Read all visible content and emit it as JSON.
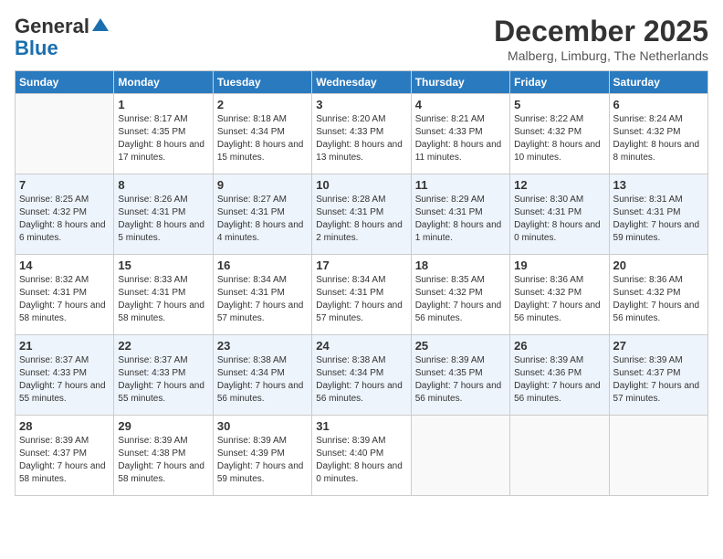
{
  "header": {
    "logo_general": "General",
    "logo_blue": "Blue",
    "month_title": "December 2025",
    "location": "Malberg, Limburg, The Netherlands"
  },
  "weekdays": [
    "Sunday",
    "Monday",
    "Tuesday",
    "Wednesday",
    "Thursday",
    "Friday",
    "Saturday"
  ],
  "weeks": [
    [
      {
        "day": "",
        "sunrise": "",
        "sunset": "",
        "daylight": ""
      },
      {
        "day": "1",
        "sunrise": "Sunrise: 8:17 AM",
        "sunset": "Sunset: 4:35 PM",
        "daylight": "Daylight: 8 hours and 17 minutes."
      },
      {
        "day": "2",
        "sunrise": "Sunrise: 8:18 AM",
        "sunset": "Sunset: 4:34 PM",
        "daylight": "Daylight: 8 hours and 15 minutes."
      },
      {
        "day": "3",
        "sunrise": "Sunrise: 8:20 AM",
        "sunset": "Sunset: 4:33 PM",
        "daylight": "Daylight: 8 hours and 13 minutes."
      },
      {
        "day": "4",
        "sunrise": "Sunrise: 8:21 AM",
        "sunset": "Sunset: 4:33 PM",
        "daylight": "Daylight: 8 hours and 11 minutes."
      },
      {
        "day": "5",
        "sunrise": "Sunrise: 8:22 AM",
        "sunset": "Sunset: 4:32 PM",
        "daylight": "Daylight: 8 hours and 10 minutes."
      },
      {
        "day": "6",
        "sunrise": "Sunrise: 8:24 AM",
        "sunset": "Sunset: 4:32 PM",
        "daylight": "Daylight: 8 hours and 8 minutes."
      }
    ],
    [
      {
        "day": "7",
        "sunrise": "Sunrise: 8:25 AM",
        "sunset": "Sunset: 4:32 PM",
        "daylight": "Daylight: 8 hours and 6 minutes."
      },
      {
        "day": "8",
        "sunrise": "Sunrise: 8:26 AM",
        "sunset": "Sunset: 4:31 PM",
        "daylight": "Daylight: 8 hours and 5 minutes."
      },
      {
        "day": "9",
        "sunrise": "Sunrise: 8:27 AM",
        "sunset": "Sunset: 4:31 PM",
        "daylight": "Daylight: 8 hours and 4 minutes."
      },
      {
        "day": "10",
        "sunrise": "Sunrise: 8:28 AM",
        "sunset": "Sunset: 4:31 PM",
        "daylight": "Daylight: 8 hours and 2 minutes."
      },
      {
        "day": "11",
        "sunrise": "Sunrise: 8:29 AM",
        "sunset": "Sunset: 4:31 PM",
        "daylight": "Daylight: 8 hours and 1 minute."
      },
      {
        "day": "12",
        "sunrise": "Sunrise: 8:30 AM",
        "sunset": "Sunset: 4:31 PM",
        "daylight": "Daylight: 8 hours and 0 minutes."
      },
      {
        "day": "13",
        "sunrise": "Sunrise: 8:31 AM",
        "sunset": "Sunset: 4:31 PM",
        "daylight": "Daylight: 7 hours and 59 minutes."
      }
    ],
    [
      {
        "day": "14",
        "sunrise": "Sunrise: 8:32 AM",
        "sunset": "Sunset: 4:31 PM",
        "daylight": "Daylight: 7 hours and 58 minutes."
      },
      {
        "day": "15",
        "sunrise": "Sunrise: 8:33 AM",
        "sunset": "Sunset: 4:31 PM",
        "daylight": "Daylight: 7 hours and 58 minutes."
      },
      {
        "day": "16",
        "sunrise": "Sunrise: 8:34 AM",
        "sunset": "Sunset: 4:31 PM",
        "daylight": "Daylight: 7 hours and 57 minutes."
      },
      {
        "day": "17",
        "sunrise": "Sunrise: 8:34 AM",
        "sunset": "Sunset: 4:31 PM",
        "daylight": "Daylight: 7 hours and 57 minutes."
      },
      {
        "day": "18",
        "sunrise": "Sunrise: 8:35 AM",
        "sunset": "Sunset: 4:32 PM",
        "daylight": "Daylight: 7 hours and 56 minutes."
      },
      {
        "day": "19",
        "sunrise": "Sunrise: 8:36 AM",
        "sunset": "Sunset: 4:32 PM",
        "daylight": "Daylight: 7 hours and 56 minutes."
      },
      {
        "day": "20",
        "sunrise": "Sunrise: 8:36 AM",
        "sunset": "Sunset: 4:32 PM",
        "daylight": "Daylight: 7 hours and 56 minutes."
      }
    ],
    [
      {
        "day": "21",
        "sunrise": "Sunrise: 8:37 AM",
        "sunset": "Sunset: 4:33 PM",
        "daylight": "Daylight: 7 hours and 55 minutes."
      },
      {
        "day": "22",
        "sunrise": "Sunrise: 8:37 AM",
        "sunset": "Sunset: 4:33 PM",
        "daylight": "Daylight: 7 hours and 55 minutes."
      },
      {
        "day": "23",
        "sunrise": "Sunrise: 8:38 AM",
        "sunset": "Sunset: 4:34 PM",
        "daylight": "Daylight: 7 hours and 56 minutes."
      },
      {
        "day": "24",
        "sunrise": "Sunrise: 8:38 AM",
        "sunset": "Sunset: 4:34 PM",
        "daylight": "Daylight: 7 hours and 56 minutes."
      },
      {
        "day": "25",
        "sunrise": "Sunrise: 8:39 AM",
        "sunset": "Sunset: 4:35 PM",
        "daylight": "Daylight: 7 hours and 56 minutes."
      },
      {
        "day": "26",
        "sunrise": "Sunrise: 8:39 AM",
        "sunset": "Sunset: 4:36 PM",
        "daylight": "Daylight: 7 hours and 56 minutes."
      },
      {
        "day": "27",
        "sunrise": "Sunrise: 8:39 AM",
        "sunset": "Sunset: 4:37 PM",
        "daylight": "Daylight: 7 hours and 57 minutes."
      }
    ],
    [
      {
        "day": "28",
        "sunrise": "Sunrise: 8:39 AM",
        "sunset": "Sunset: 4:37 PM",
        "daylight": "Daylight: 7 hours and 58 minutes."
      },
      {
        "day": "29",
        "sunrise": "Sunrise: 8:39 AM",
        "sunset": "Sunset: 4:38 PM",
        "daylight": "Daylight: 7 hours and 58 minutes."
      },
      {
        "day": "30",
        "sunrise": "Sunrise: 8:39 AM",
        "sunset": "Sunset: 4:39 PM",
        "daylight": "Daylight: 7 hours and 59 minutes."
      },
      {
        "day": "31",
        "sunrise": "Sunrise: 8:39 AM",
        "sunset": "Sunset: 4:40 PM",
        "daylight": "Daylight: 8 hours and 0 minutes."
      },
      {
        "day": "",
        "sunrise": "",
        "sunset": "",
        "daylight": ""
      },
      {
        "day": "",
        "sunrise": "",
        "sunset": "",
        "daylight": ""
      },
      {
        "day": "",
        "sunrise": "",
        "sunset": "",
        "daylight": ""
      }
    ]
  ]
}
